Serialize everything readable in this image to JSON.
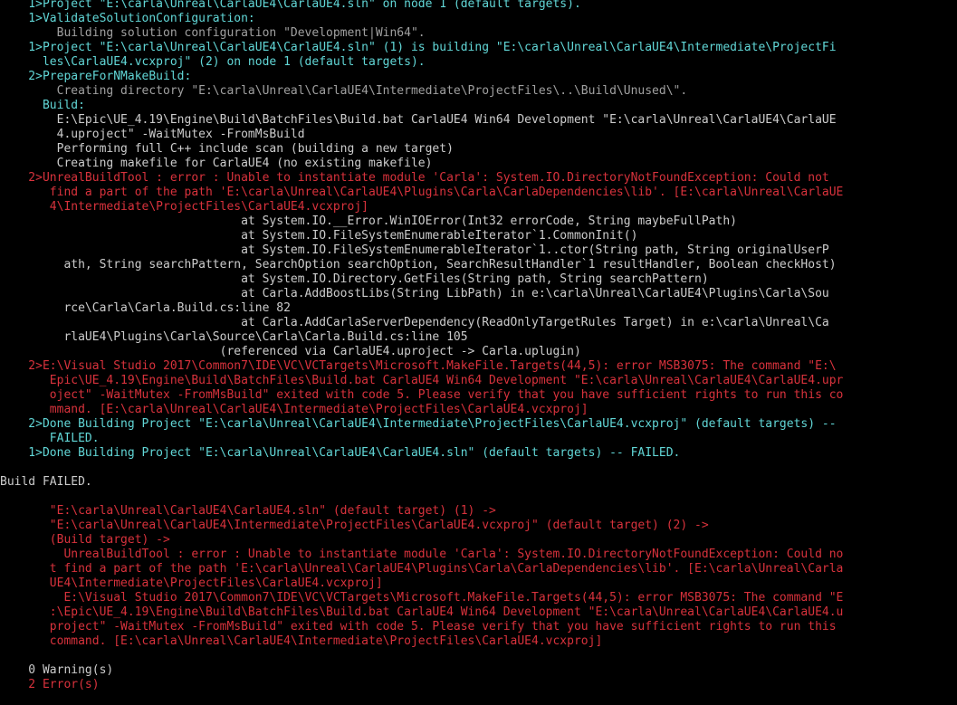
{
  "lines": [
    {
      "text": "    1>Project \"E:\\carla\\Unreal\\CarlaUE4\\CarlaUE4.sln\" on node 1 (default targets).",
      "color": "cyan"
    },
    {
      "text": "    1>ValidateSolutionConfiguration:",
      "color": "cyan"
    },
    {
      "text": "        Building solution configuration \"Development|Win64\".",
      "color": "gray"
    },
    {
      "text": "    1>Project \"E:\\carla\\Unreal\\CarlaUE4\\CarlaUE4.sln\" (1) is building \"E:\\carla\\Unreal\\CarlaUE4\\Intermediate\\ProjectFi",
      "color": "cyan"
    },
    {
      "text": "      les\\CarlaUE4.vcxproj\" (2) on node 1 (default targets).",
      "color": "cyan"
    },
    {
      "text": "    2>PrepareForNMakeBuild:",
      "color": "cyan"
    },
    {
      "text": "        Creating directory \"E:\\carla\\Unreal\\CarlaUE4\\Intermediate\\ProjectFiles\\..\\Build\\Unused\\\".",
      "color": "gray"
    },
    {
      "text": "      Build:",
      "color": "cyan"
    },
    {
      "text": "        E:\\Epic\\UE_4.19\\Engine\\Build\\BatchFiles\\Build.bat CarlaUE4 Win64 Development \"E:\\carla\\Unreal\\CarlaUE4\\CarlaUE",
      "color": "white"
    },
    {
      "text": "        4.uproject\" -WaitMutex -FromMsBuild",
      "color": "white"
    },
    {
      "text": "        Performing full C++ include scan (building a new target)",
      "color": "white"
    },
    {
      "text": "        Creating makefile for CarlaUE4 (no existing makefile)",
      "color": "white"
    },
    {
      "text": "    2>UnrealBuildTool : error : Unable to instantiate module 'Carla': System.IO.DirectoryNotFoundException: Could not",
      "color": "red"
    },
    {
      "text": "       find a part of the path 'E:\\carla\\Unreal\\CarlaUE4\\Plugins\\Carla\\CarlaDependencies\\lib'. [E:\\carla\\Unreal\\CarlaUE",
      "color": "red"
    },
    {
      "text": "       4\\Intermediate\\ProjectFiles\\CarlaUE4.vcxproj]",
      "color": "red"
    },
    {
      "text": "                                  at System.IO.__Error.WinIOError(Int32 errorCode, String maybeFullPath)",
      "color": "white"
    },
    {
      "text": "                                  at System.IO.FileSystemEnumerableIterator`1.CommonInit()",
      "color": "white"
    },
    {
      "text": "                                  at System.IO.FileSystemEnumerableIterator`1..ctor(String path, String originalUserP",
      "color": "white"
    },
    {
      "text": "         ath, String searchPattern, SearchOption searchOption, SearchResultHandler`1 resultHandler, Boolean checkHost)",
      "color": "white"
    },
    {
      "text": "                                  at System.IO.Directory.GetFiles(String path, String searchPattern)",
      "color": "white"
    },
    {
      "text": "                                  at Carla.AddBoostLibs(String LibPath) in e:\\carla\\Unreal\\CarlaUE4\\Plugins\\Carla\\Sou",
      "color": "white"
    },
    {
      "text": "         rce\\Carla\\Carla.Build.cs:line 82",
      "color": "white"
    },
    {
      "text": "                                  at Carla.AddCarlaServerDependency(ReadOnlyTargetRules Target) in e:\\carla\\Unreal\\Ca",
      "color": "white"
    },
    {
      "text": "         rlaUE4\\Plugins\\Carla\\Source\\Carla\\Carla.Build.cs:line 105",
      "color": "white"
    },
    {
      "text": "                               (referenced via CarlaUE4.uproject -> Carla.uplugin)",
      "color": "white"
    },
    {
      "text": "    2>E:\\Visual Studio 2017\\Common7\\IDE\\VC\\VCTargets\\Microsoft.MakeFile.Targets(44,5): error MSB3075: The command \"E:\\",
      "color": "red"
    },
    {
      "text": "       Epic\\UE_4.19\\Engine\\Build\\BatchFiles\\Build.bat CarlaUE4 Win64 Development \"E:\\carla\\Unreal\\CarlaUE4\\CarlaUE4.upr",
      "color": "red"
    },
    {
      "text": "       oject\" -WaitMutex -FromMsBuild\" exited with code 5. Please verify that you have sufficient rights to run this co",
      "color": "red"
    },
    {
      "text": "       mmand. [E:\\carla\\Unreal\\CarlaUE4\\Intermediate\\ProjectFiles\\CarlaUE4.vcxproj]",
      "color": "red"
    },
    {
      "text": "    2>Done Building Project \"E:\\carla\\Unreal\\CarlaUE4\\Intermediate\\ProjectFiles\\CarlaUE4.vcxproj\" (default targets) --",
      "color": "cyan"
    },
    {
      "text": "       FAILED.",
      "color": "cyan"
    },
    {
      "text": "    1>Done Building Project \"E:\\carla\\Unreal\\CarlaUE4\\CarlaUE4.sln\" (default targets) -- FAILED.",
      "color": "cyan"
    },
    {
      "text": "",
      "color": "white"
    },
    {
      "text": "Build FAILED.",
      "color": "white"
    },
    {
      "text": "",
      "color": "white"
    },
    {
      "text": "       \"E:\\carla\\Unreal\\CarlaUE4\\CarlaUE4.sln\" (default target) (1) ->",
      "color": "red"
    },
    {
      "text": "       \"E:\\carla\\Unreal\\CarlaUE4\\Intermediate\\ProjectFiles\\CarlaUE4.vcxproj\" (default target) (2) ->",
      "color": "red"
    },
    {
      "text": "       (Build target) ->",
      "color": "red"
    },
    {
      "text": "         UnrealBuildTool : error : Unable to instantiate module 'Carla': System.IO.DirectoryNotFoundException: Could no",
      "color": "red"
    },
    {
      "text": "       t find a part of the path 'E:\\carla\\Unreal\\CarlaUE4\\Plugins\\Carla\\CarlaDependencies\\lib'. [E:\\carla\\Unreal\\Carla",
      "color": "red"
    },
    {
      "text": "       UE4\\Intermediate\\ProjectFiles\\CarlaUE4.vcxproj]",
      "color": "red"
    },
    {
      "text": "         E:\\Visual Studio 2017\\Common7\\IDE\\VC\\VCTargets\\Microsoft.MakeFile.Targets(44,5): error MSB3075: The command \"E",
      "color": "red"
    },
    {
      "text": "       :\\Epic\\UE_4.19\\Engine\\Build\\BatchFiles\\Build.bat CarlaUE4 Win64 Development \"E:\\carla\\Unreal\\CarlaUE4\\CarlaUE4.u",
      "color": "red"
    },
    {
      "text": "       project\" -WaitMutex -FromMsBuild\" exited with code 5. Please verify that you have sufficient rights to run this",
      "color": "red"
    },
    {
      "text": "       command. [E:\\carla\\Unreal\\CarlaUE4\\Intermediate\\ProjectFiles\\CarlaUE4.vcxproj]",
      "color": "red"
    },
    {
      "text": "",
      "color": "white"
    },
    {
      "text": "    0 Warning(s)",
      "color": "white"
    },
    {
      "text": "    2 Error(s)",
      "color": "red"
    }
  ]
}
